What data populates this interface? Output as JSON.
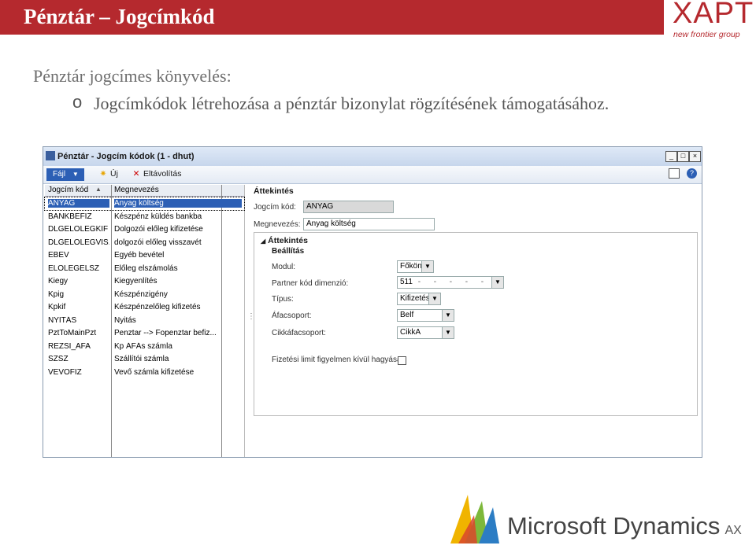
{
  "slide": {
    "title": "Pénztár – Jogcímkód",
    "heading": "Pénztár jogcímes könyvelés:",
    "bullet_marker": "o",
    "bullet_text": "Jogcímkódok létrehozása a pénztár bizonylat rögzítésének támogatásához.",
    "logo_brand": "XAPT",
    "logo_tagline": "new frontier group",
    "footer_logo": "Microsoft Dynamics",
    "footer_logo_suffix": "AX",
    "brand_color": "#b5292e"
  },
  "window": {
    "title": "Pénztár - Jogcím kódok (1 - dhut)",
    "controls": {
      "minimize": "_",
      "maximize": "□",
      "close": "×"
    },
    "toolbar": {
      "file_label": "Fájl",
      "new_label": "Új",
      "delete_label": "Eltávolítás"
    },
    "grid": {
      "columns": [
        "Jogcím kód",
        "Megnevezés"
      ],
      "rows": [
        {
          "code": "ANYAG",
          "name": "Anyag költség"
        },
        {
          "code": "BANKBEFIZ",
          "name": "Készpénz küldés bankba"
        },
        {
          "code": "DLGELOLEGKIF",
          "name": "Dolgozói előleg kifizetése"
        },
        {
          "code": "DLGELOLEGVIS...",
          "name": "dolgozói előleg visszavét"
        },
        {
          "code": "EBEV",
          "name": "Egyéb bevétel"
        },
        {
          "code": "ELOLEGELSZ",
          "name": "Előleg elszámolás"
        },
        {
          "code": "Kiegy",
          "name": "Kiegyenlítés"
        },
        {
          "code": "Kpig",
          "name": "Készpénzigény"
        },
        {
          "code": "Kpkif",
          "name": "Készpénzelőleg kifizetés"
        },
        {
          "code": "NYITÁS",
          "name": "Nyitás"
        },
        {
          "code": "PztToMainPzt",
          "name": "Penztar --> Fopenztar befiz..."
        },
        {
          "code": "REZSI_AFA",
          "name": "Kp ÁFÁs számla"
        },
        {
          "code": "SZSZ",
          "name": "Szállítói számla"
        },
        {
          "code": "VEVOFIZ",
          "name": "Vevő számla kifizetése"
        }
      ]
    },
    "detail": {
      "overview_header": "Áttekintés",
      "code_label": "Jogcím kód:",
      "code_value": "ANYAG",
      "name_label": "Megnevezés:",
      "name_value": "Anyag költség",
      "sub_header": "Áttekintés",
      "settings_header": "Beállítás",
      "module_label": "Modul:",
      "module_value": "Főköny",
      "partner_label": "Partner kód dimenzió:",
      "partner_value": "511",
      "partner_dashes": "-      -      -      -      -",
      "type_label": "Típus:",
      "type_value": "Kifizetés",
      "vat_group_label": "Áfacsoport:",
      "vat_group_value": "Belf",
      "item_vat_label": "Cikkáfacsoport:",
      "item_vat_value": "CikkA",
      "limit_label": "Fizetési limit figyelmen kívül hagyása:",
      "limit_checked": false
    }
  }
}
